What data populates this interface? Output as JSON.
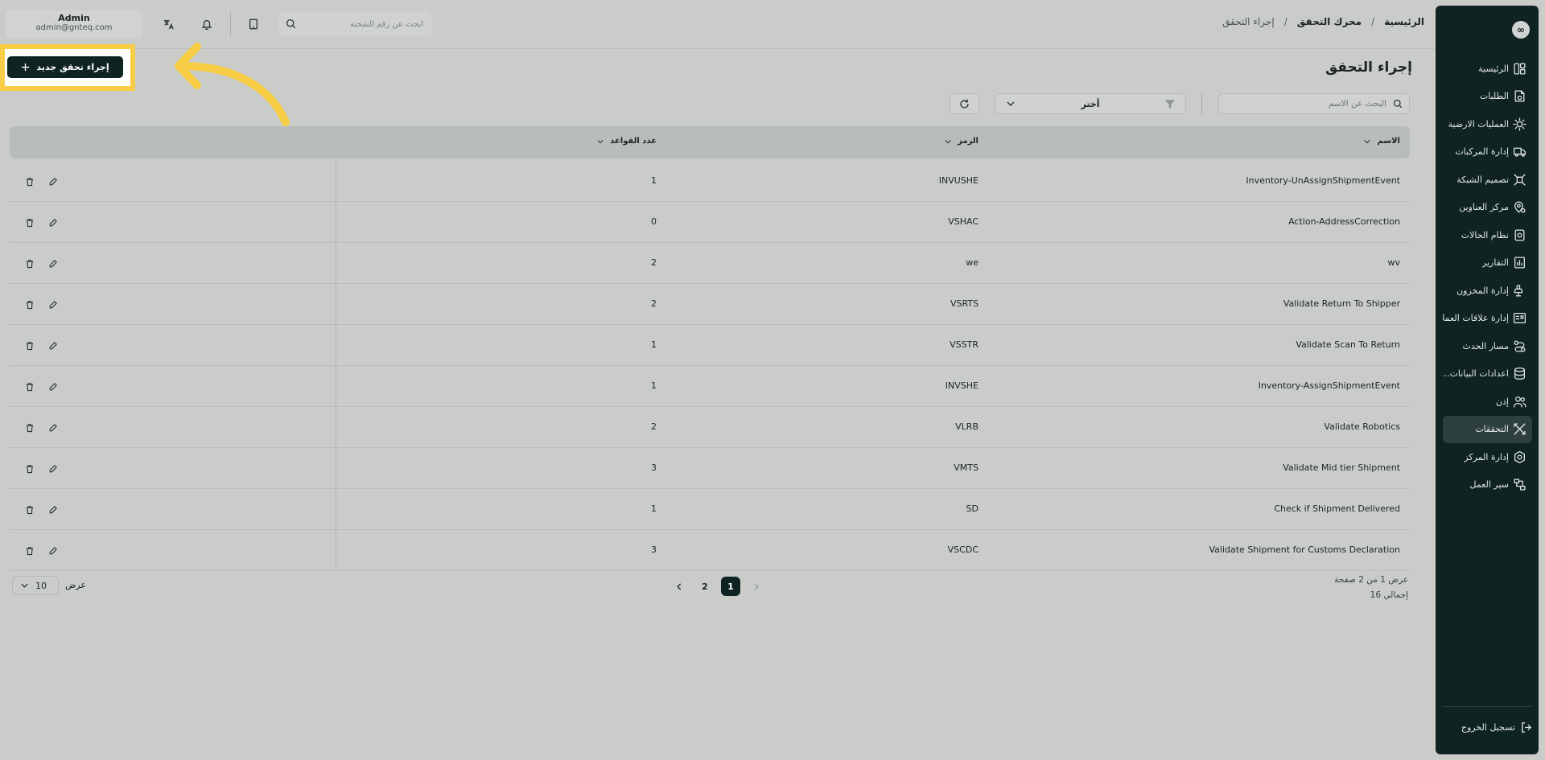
{
  "header": {
    "breadcrumbs": [
      "الرئيسية",
      "محرك التحقق",
      "إجراء التحقق"
    ],
    "search_placeholder": "ابحث عن رقم الشحنة",
    "user": {
      "name": "Admin",
      "email": "admin@gnteq.com"
    }
  },
  "sidebar": {
    "logo": "∞",
    "items": [
      {
        "label": "الرئيسية",
        "icon": "dashboard-icon"
      },
      {
        "label": "الطلبات",
        "icon": "orders-icon"
      },
      {
        "label": "العمليات الارضية",
        "icon": "ground-ops-icon"
      },
      {
        "label": "إدارة المركبات",
        "icon": "truck-icon"
      },
      {
        "label": "تصميم الشبكة",
        "icon": "network-icon"
      },
      {
        "label": "مركز العناوين",
        "icon": "location-icon"
      },
      {
        "label": "نظام الحالات",
        "icon": "status-icon"
      },
      {
        "label": "التقارير",
        "icon": "reports-icon"
      },
      {
        "label": "إدارة المخزون",
        "icon": "inventory-icon"
      },
      {
        "label": "إدارة علاقات العملاء",
        "icon": "crm-icon"
      },
      {
        "label": "مسار الحدث",
        "icon": "route-icon"
      },
      {
        "label": "اعدادات البيانات...",
        "icon": "database-icon"
      },
      {
        "label": "إذن",
        "icon": "users-icon"
      },
      {
        "label": "التحققات",
        "icon": "validation-icon",
        "active": true
      },
      {
        "label": "إدارة المركز",
        "icon": "hub-icon"
      },
      {
        "label": "سير العمل",
        "icon": "workflow-icon"
      }
    ],
    "logout": "تسجيل الخروج"
  },
  "page": {
    "title": "إجراء التحقق",
    "new_button": "إجراء تحقق جديد"
  },
  "toolbar": {
    "search_placeholder": "البحث عن الاسم",
    "filter_value": "أختر"
  },
  "table": {
    "columns": {
      "name": "الاسم",
      "code": "الرمز",
      "rules": "عدد القواعد"
    },
    "rows": [
      {
        "name": "Inventory-UnAssignShipmentEvent",
        "code": "INVUSHE",
        "rules": "1"
      },
      {
        "name": "Action-AddressCorrection",
        "code": "VSHAC",
        "rules": "0"
      },
      {
        "name": "wv",
        "code": "we",
        "rules": "2"
      },
      {
        "name": "Validate Return To Shipper",
        "code": "VSRTS",
        "rules": "2"
      },
      {
        "name": "Validate Scan To Return",
        "code": "VSSTR",
        "rules": "1"
      },
      {
        "name": "Inventory-AssignShipmentEvent",
        "code": "INVSHE",
        "rules": "1"
      },
      {
        "name": "Validate Robotics",
        "code": "VLRB",
        "rules": "2"
      },
      {
        "name": "Validate Mid tier Shipment",
        "code": "VMTS",
        "rules": "3"
      },
      {
        "name": "Check if Shipment Delivered",
        "code": "SD",
        "rules": "1"
      },
      {
        "name": "Validate Shipment for Customs Declaration",
        "code": "VSCDC",
        "rules": "3"
      }
    ]
  },
  "pagination": {
    "summary_line1": "عرض 1 من 2 صفحة",
    "summary_line2": "إجمالي 16",
    "pages": [
      "1",
      "2"
    ],
    "current": "1",
    "per_page_label": "عرض",
    "per_page_value": "10"
  },
  "colors": {
    "accent": "#0e2322",
    "highlight": "#f7cd45",
    "background": "#c9ccc9"
  }
}
